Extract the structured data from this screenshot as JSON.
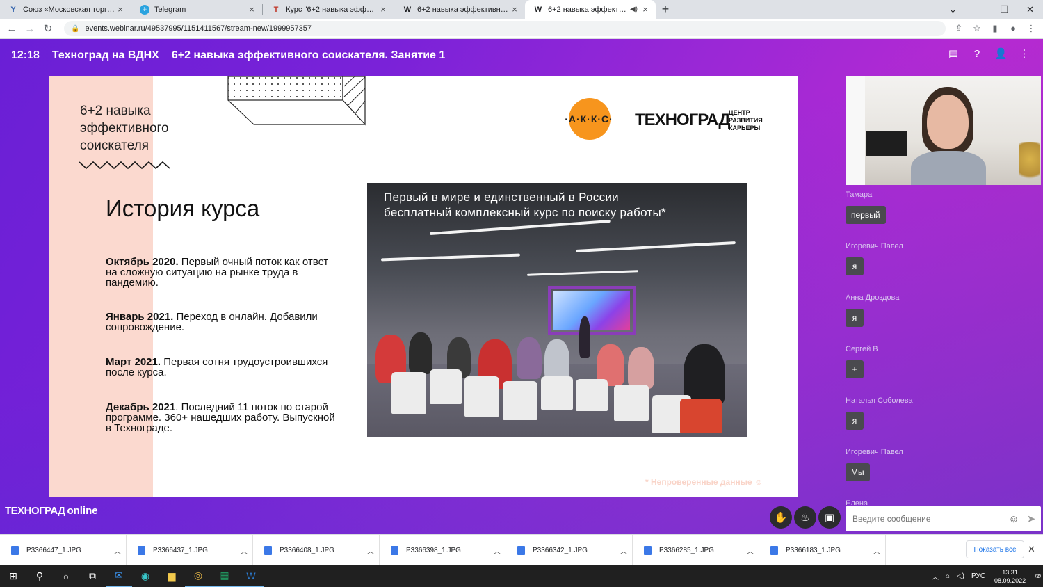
{
  "browser": {
    "tabs": [
      {
        "icon": "Y",
        "label": "Союз «Московская торгово-пр",
        "active": false
      },
      {
        "icon": "✈",
        "label": "Telegram",
        "active": false
      },
      {
        "icon": "T",
        "label": "Курс \"6+2 навыка эффективно",
        "active": false
      },
      {
        "icon": "W",
        "label": "6+2 навыка эффективного сои",
        "active": false
      },
      {
        "icon": "W",
        "label": "6+2 навыка эффективного",
        "active": true
      }
    ],
    "url": "events.webinar.ru/49537995/1151411567/stream-new/1999957357"
  },
  "webinar": {
    "time": "12:18",
    "org": "Техноград на ВДНХ",
    "title": "6+2 навыка эффективного соискателя. Занятие 1"
  },
  "slide": {
    "course_title": [
      "6+2 навыка",
      "эффективного",
      "соискателя"
    ],
    "heading": "История курса",
    "events": [
      {
        "date": "Октябрь 2020.",
        "text": " Первый очный поток как ответ на сложную ситуацию на рынке труда в пандемию."
      },
      {
        "date": "Январь 2021.",
        "text": " Переход в онлайн. Добавили сопровождение."
      },
      {
        "date": "Март 2021.",
        "text": " Первая сотня трудоустроившихся после курса."
      },
      {
        "date": "Декабрь 2021",
        "text": ". Последний 11 поток по старой программе. 360+ нашедших работу. Выпускной в Технограде."
      }
    ],
    "logo_akks": "·А·К·К·С·",
    "logo_tech": "ТЕХНОГРАД",
    "logo_center": [
      "ЦЕНТР",
      "РАЗВИТИЯ",
      "КАРЬЕРЫ"
    ],
    "photo_caption": [
      "Первый в мире и единственный в России",
      "бесплатный комплексный курс по поиску работы*"
    ],
    "footnote": "* Непроверенные данные ☺"
  },
  "chat": {
    "messages": [
      {
        "author": "Тамара",
        "text": "первый"
      },
      {
        "author": "Игоревич Павел",
        "text": "я"
      },
      {
        "author": "Анна Дроздова",
        "text": "я"
      },
      {
        "author": "Сергей В",
        "text": "+"
      },
      {
        "author": "Наталья Соболева",
        "text": "я"
      },
      {
        "author": "Игоревич Павел",
        "text": "Мы"
      },
      {
        "author": "Елена",
        "text": ""
      }
    ],
    "placeholder": "Введите сообщение"
  },
  "watermark": {
    "brand": "ТЕХНОГРАД",
    "suffix": "online"
  },
  "downloads": {
    "files": [
      "P3366447_1.JPG",
      "P3366437_1.JPG",
      "P3366408_1.JPG",
      "P3366398_1.JPG",
      "P3366342_1.JPG",
      "P3366285_1.JPG",
      "P3366183_1.JPG"
    ],
    "show_all": "Показать все"
  },
  "taskbar": {
    "lang": "РУС",
    "time": "13:31",
    "date": "08.09.2022",
    "notifications": "2"
  }
}
